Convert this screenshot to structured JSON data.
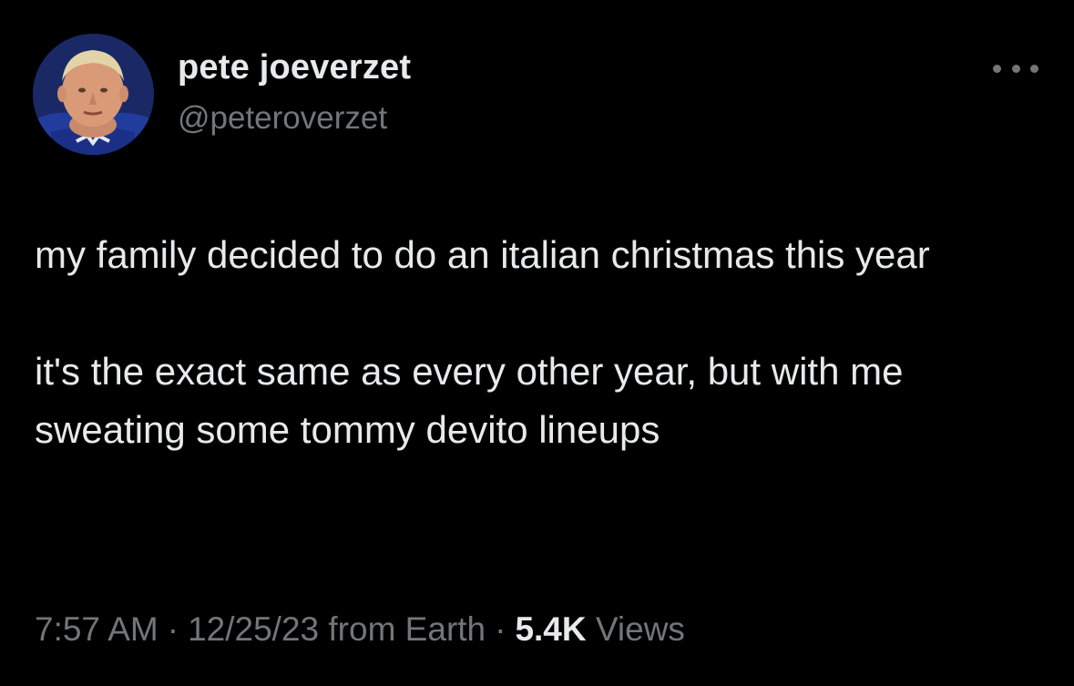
{
  "author": {
    "display_name": "pete joeverzet",
    "handle": "@peteroverzet",
    "avatar_icon": "profile-photo-avatar"
  },
  "more_icon": "more-horizontal-icon",
  "tweet": {
    "paragraphs": [
      "my family decided to do an italian christmas this year",
      "it's the exact same as every other year, but with me sweating some tommy devito lineups"
    ]
  },
  "meta": {
    "time": "7:57 AM",
    "separator": "·",
    "date": "12/25/23",
    "source": "from Earth",
    "views_count": "5.4K",
    "views_label": "Views"
  },
  "colors": {
    "background": "#000000",
    "primary_text": "#e7e9ea",
    "secondary_text": "#71767b"
  }
}
